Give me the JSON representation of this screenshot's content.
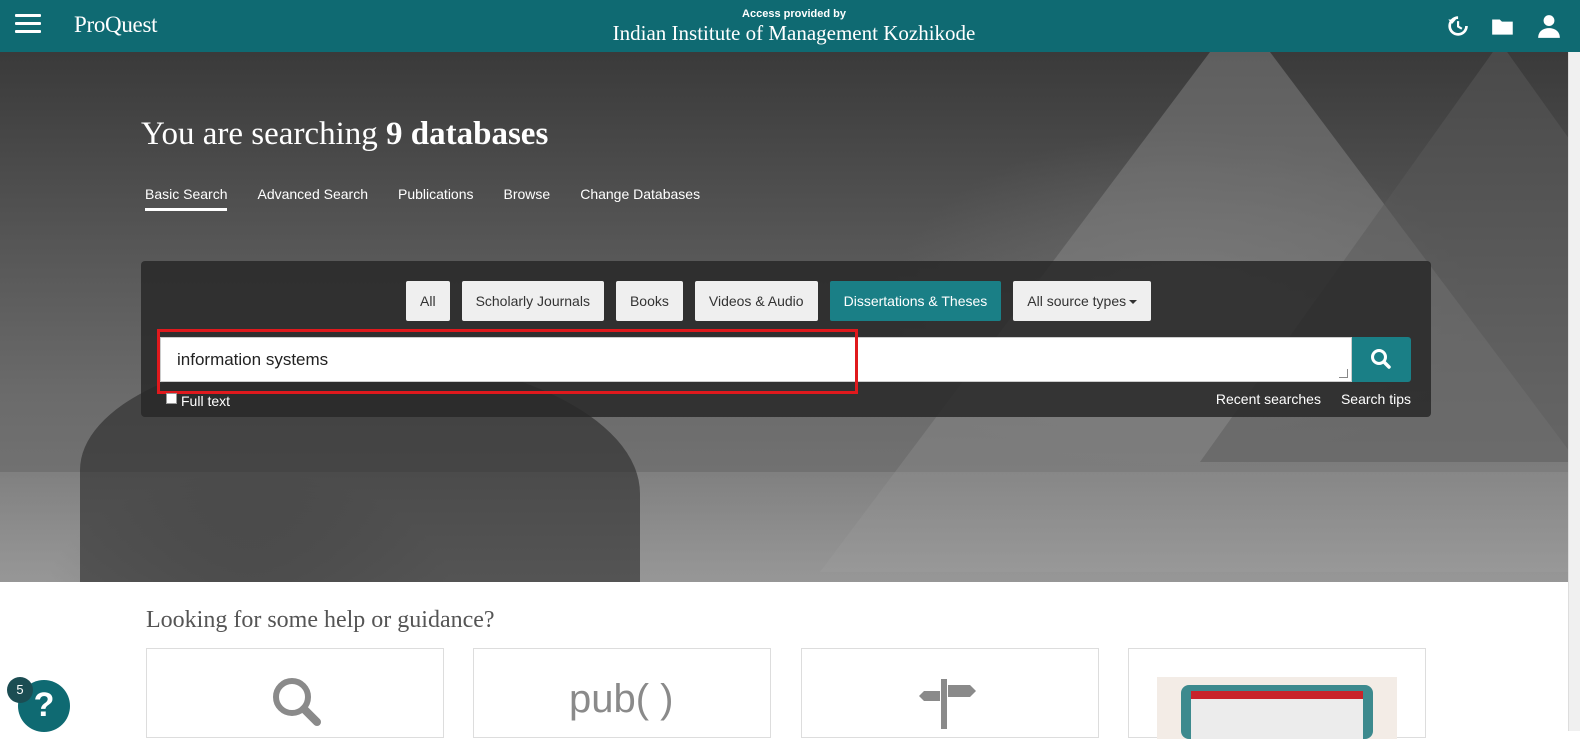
{
  "header": {
    "logo": "ProQuest",
    "access_label": "Access provided by",
    "institution": "Indian Institute of Management Kozhikode",
    "icons": [
      "menu-icon",
      "history-icon",
      "folder-icon",
      "user-icon"
    ]
  },
  "hero": {
    "title_prefix": "You are searching",
    "title_bold": "9 databases",
    "tabs": [
      {
        "label": "Basic Search",
        "active": true
      },
      {
        "label": "Advanced Search"
      },
      {
        "label": "Publications"
      },
      {
        "label": "Browse"
      },
      {
        "label": "Change Databases"
      }
    ]
  },
  "search": {
    "source_types": [
      {
        "label": "All"
      },
      {
        "label": "Scholarly Journals"
      },
      {
        "label": "Books"
      },
      {
        "label": "Videos & Audio"
      },
      {
        "label": "Dissertations & Theses",
        "active": true
      },
      {
        "label": "All source types",
        "dropdown": true
      }
    ],
    "query": "information systems",
    "full_text_label": "Full text",
    "full_text_checked": false,
    "recent_searches": "Recent searches",
    "search_tips": "Search tips"
  },
  "help": {
    "title": "Looking for some help or guidance?",
    "card2_text": "pub( )"
  },
  "help_bubble": {
    "symbol": "?",
    "count": "5"
  },
  "colors": {
    "brand": "#0f6a72",
    "accent": "#1a7f86",
    "highlight": "#e0191d"
  }
}
